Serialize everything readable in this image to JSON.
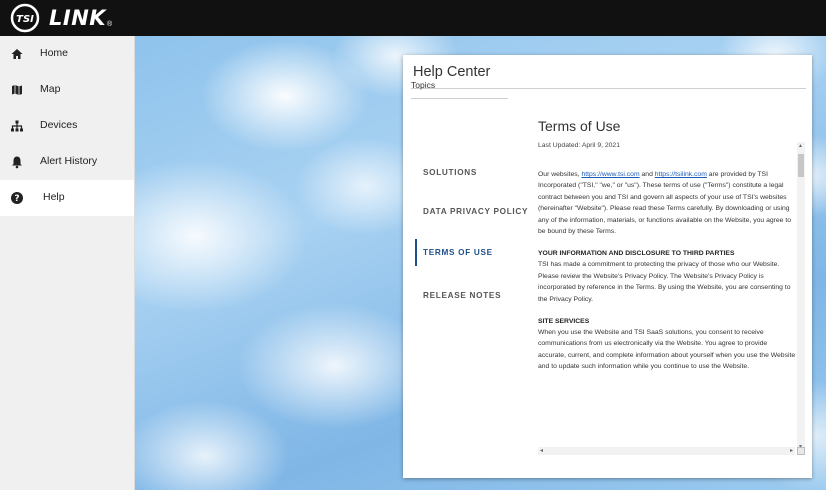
{
  "app": {
    "logo_text": "LINK",
    "logo_mark": "TSI",
    "logo_reg": "®"
  },
  "sidebar": {
    "items": [
      {
        "label": "Home",
        "icon": "home-icon"
      },
      {
        "label": "Map",
        "icon": "map-icon"
      },
      {
        "label": "Devices",
        "icon": "devices-icon"
      },
      {
        "label": "Alert History",
        "icon": "bell-icon"
      },
      {
        "label": "Help",
        "icon": "help-icon",
        "active": true
      }
    ]
  },
  "help": {
    "title": "Help Center",
    "topics_label": "Topics",
    "tabs": [
      {
        "label": "SOLUTIONS"
      },
      {
        "label": "DATA PRIVACY POLICY"
      },
      {
        "label": "TERMS OF USE",
        "active": true
      },
      {
        "label": "RELEASE NOTES"
      }
    ],
    "accent": "#1f4f8c"
  },
  "document": {
    "title": "Terms of Use",
    "updated": "Last Updated: April 9, 2021",
    "intro_pre": "Our websites, ",
    "link1": "https://www.tsi.com",
    "intro_mid": " and ",
    "link2": "https://tsilink.com",
    "intro_post": " are provided by TSI Incorporated (\"TSI,\" \"we,\" or \"us\"). These terms of use (\"Terms\") constitute a legal contract between you and TSI and govern all aspects of your use of TSI's websites (hereinafter \"Website\"). Please read these Terms carefully. By downloading or using any of the information, materials, or functions available on the Website, you agree to be bound by these Terms.",
    "sec1_head": "YOUR INFORMATION AND DISCLOSURE TO THIRD PARTIES",
    "sec1_body": "TSI has made a commitment to protecting the privacy of those who our Website. Please review the Website's Privacy Policy. The Website's Privacy Policy is incorporated by reference in the Terms. By using the Website, you are consenting to the Privacy Policy.",
    "sec2_head": "SITE SERVICES",
    "sec2_body": "When you use the Website and TSI SaaS solutions, you consent to receive communications from us electronically via the Website. You agree to provide accurate, current, and complete information about yourself when you use the Website and to update such information while you continue to use the Website."
  }
}
